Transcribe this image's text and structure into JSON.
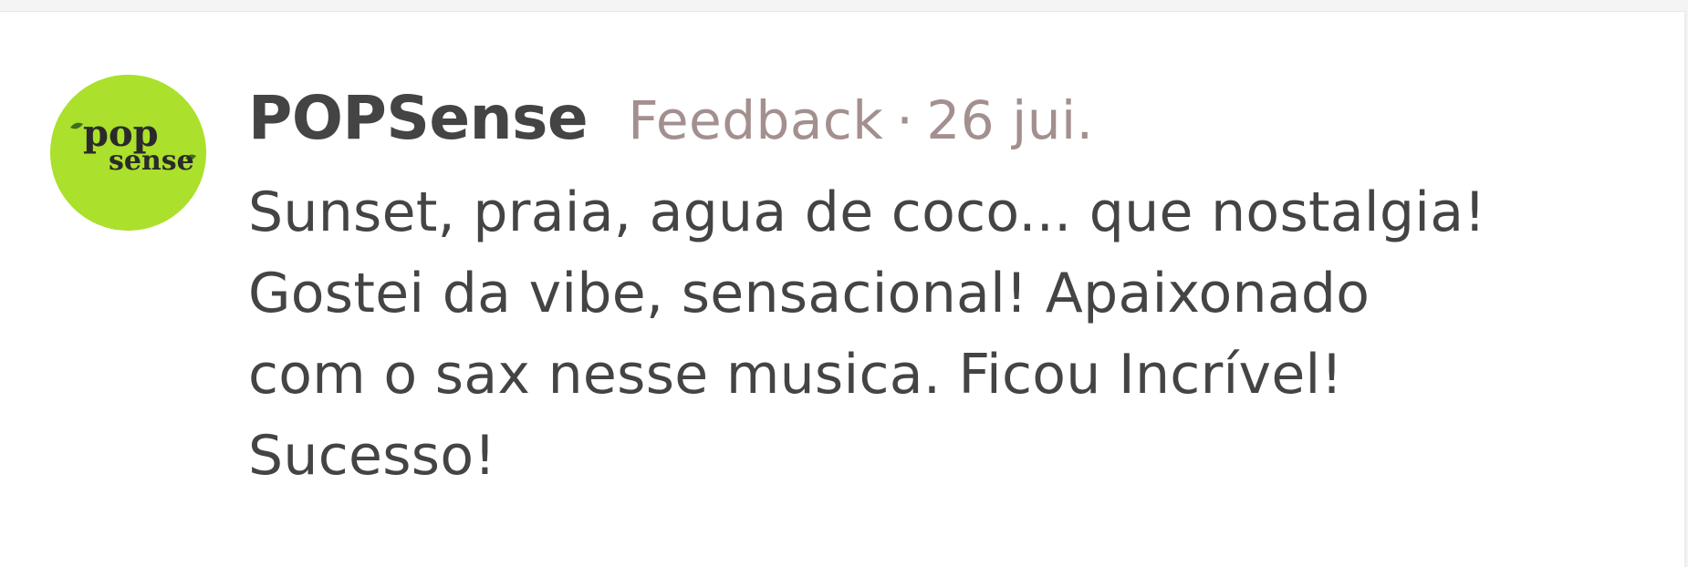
{
  "comment": {
    "avatar": {
      "icon": "popsense-logo-icon",
      "color": "#abe02c",
      "logo_text": "popsense"
    },
    "author": "POPSense",
    "tag": "Feedback",
    "separator": "·",
    "date": "26 jui.",
    "text": "Sunset, praia, agua de coco... que nostalgia!\nGostei da vibe, sensacional! Apaixonado\ncom o sax nesse musica. Ficou Incrível!\nSucesso!"
  }
}
